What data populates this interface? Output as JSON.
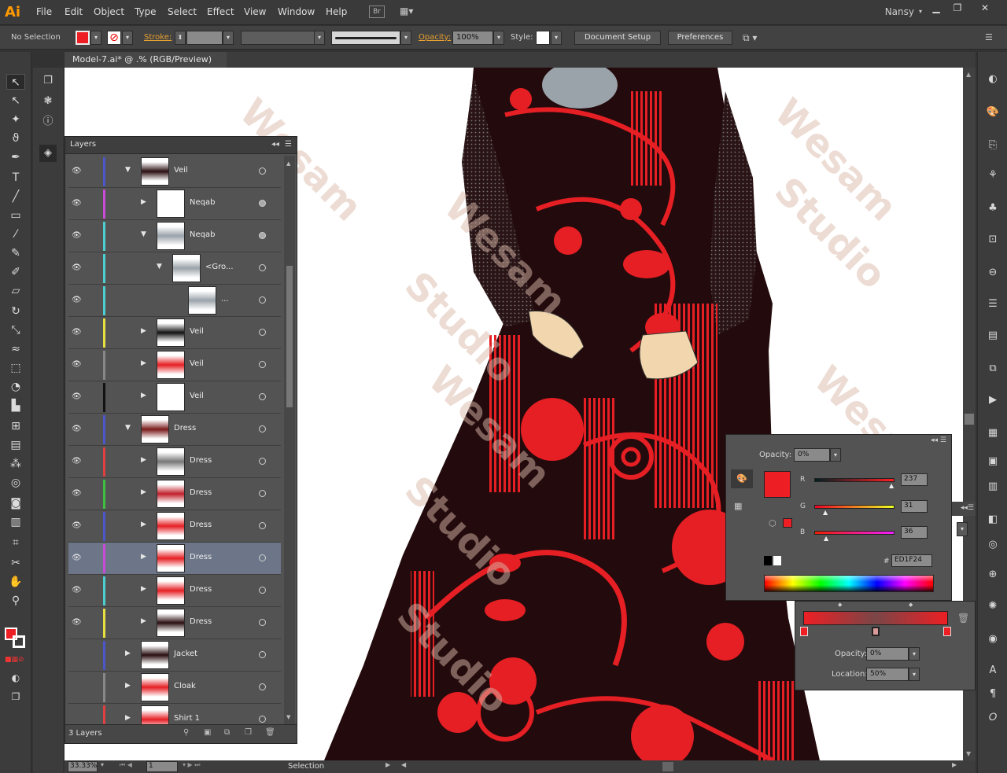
{
  "app": {
    "logo": "Ai",
    "user": "Nansy",
    "bridge_label": "Br"
  },
  "menu": [
    "File",
    "Edit",
    "Object",
    "Type",
    "Select",
    "Effect",
    "View",
    "Window",
    "Help"
  ],
  "control": {
    "selection": "No Selection",
    "stroke_label": "Stroke:",
    "opacity_label": "Opacity:",
    "opacity_value": "100%",
    "style_label": "Style:",
    "doc_setup": "Document Setup",
    "preferences": "Preferences"
  },
  "document": {
    "tab_title": "Model-7.ai* @ .% (RGB/Preview)",
    "close": "×"
  },
  "layers": {
    "title": "Layers",
    "footer": "3 Layers",
    "rows": [
      {
        "name": "Veil",
        "color": "#4b56c8"
      },
      {
        "name": "Neqab",
        "color": "#c84bd8"
      },
      {
        "name": "Neqab",
        "color": "#4bcfd0"
      },
      {
        "name": "<Gro...",
        "color": "#4bcfd0"
      },
      {
        "name": "...",
        "color": "#4bcfd0"
      },
      {
        "name": "Veil",
        "color": "#e8e040"
      },
      {
        "name": "Veil",
        "color": "#888888"
      },
      {
        "name": "Veil",
        "color": "#111111"
      },
      {
        "name": "Dress",
        "color": "#4b56c8"
      },
      {
        "name": "Dress",
        "color": "#e04040"
      },
      {
        "name": "Dress",
        "color": "#40c040"
      },
      {
        "name": "Dress",
        "color": "#4b56c8"
      },
      {
        "name": "Dress",
        "color": "#c84bd8"
      },
      {
        "name": "Dress",
        "color": "#4bcfd0"
      },
      {
        "name": "Dress",
        "color": "#e8e040"
      },
      {
        "name": "Jacket",
        "color": "#4b56c8"
      },
      {
        "name": "Cloak",
        "color": "#888888"
      },
      {
        "name": "Shirt 1",
        "color": "#e04040"
      }
    ]
  },
  "color_panel": {
    "opacity_label": "Opacity:",
    "opacity_value": "0%",
    "r_label": "R",
    "g_label": "G",
    "b_label": "B",
    "r": "237",
    "g": "31",
    "b": "36",
    "hex_label": "#",
    "hex": "ED1F24",
    "swatch": "#ED1F24"
  },
  "gradient_panel": {
    "opacity_label": "Opacity:",
    "opacity_value": "0%",
    "location_label": "Location:",
    "location_value": "50%"
  },
  "status": {
    "zoom": "33.33%",
    "artboard": "1",
    "tool": "Selection"
  }
}
